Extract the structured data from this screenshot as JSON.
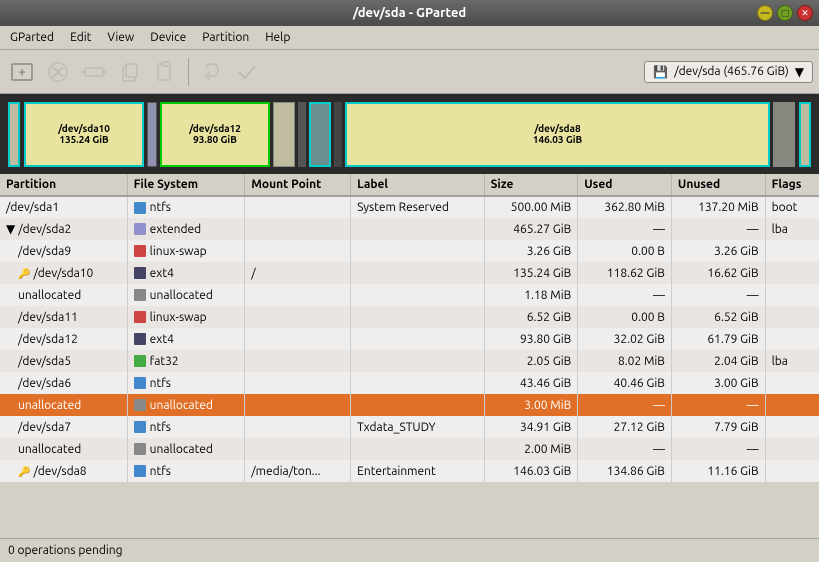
{
  "titlebar": {
    "title": "/dev/sda - GParted"
  },
  "menubar": {
    "items": [
      "GParted",
      "Edit",
      "View",
      "Device",
      "Partition",
      "Help"
    ]
  },
  "toolbar": {
    "icons": [
      {
        "name": "new-partition-icon",
        "symbol": "⊕",
        "disabled": false
      },
      {
        "name": "delete-icon",
        "symbol": "⊘",
        "disabled": false
      },
      {
        "name": "resize-icon",
        "symbol": "⇔",
        "disabled": false
      },
      {
        "name": "copy-icon",
        "symbol": "⎘",
        "disabled": false
      },
      {
        "name": "paste-icon",
        "symbol": "📋",
        "disabled": false
      },
      {
        "name": "undo-icon",
        "symbol": "↩",
        "disabled": false
      },
      {
        "name": "apply-icon",
        "symbol": "✓",
        "disabled": false
      }
    ],
    "device_label": "/dev/sda  (465.76 GiB)",
    "device_icon": "💾"
  },
  "disk_visual": {
    "parts": [
      {
        "id": "sda1",
        "label": "",
        "size": "",
        "style": "sda1"
      },
      {
        "id": "sda10",
        "label": "/dev/sda10",
        "size": "135.24 GiB",
        "style": "sda10"
      },
      {
        "id": "sda12",
        "label": "/dev/sda12",
        "size": "93.80 GiB",
        "style": "sda12"
      },
      {
        "id": "sda8",
        "label": "/dev/sda8",
        "size": "146.03 GiB",
        "style": "sda8"
      }
    ]
  },
  "table": {
    "headers": [
      "Partition",
      "File System",
      "Mount Point",
      "Label",
      "Size",
      "Used",
      "Unused",
      "Flags"
    ],
    "rows": [
      {
        "partition": "/dev/sda1",
        "indent": 0,
        "fs": "ntfs",
        "fs_color": "#4488cc",
        "mount": "",
        "label": "System Reserved",
        "size": "500.00 MiB",
        "used": "362.80 MiB",
        "unused": "137.20 MiB",
        "flags": "boot",
        "selected": false
      },
      {
        "partition": "/dev/sda2",
        "indent": 0,
        "fs": "extended",
        "fs_color": "#8888cc",
        "mount": "",
        "label": "",
        "size": "465.27 GiB",
        "used": "—",
        "unused": "—",
        "flags": "lba",
        "selected": false,
        "expand": true
      },
      {
        "partition": "/dev/sda9",
        "indent": 1,
        "fs": "linux-swap",
        "fs_color": "#cc4444",
        "mount": "",
        "label": "",
        "size": "3.26 GiB",
        "used": "0.00 B",
        "unused": "3.26 GiB",
        "flags": "",
        "selected": false
      },
      {
        "partition": "/dev/sda10",
        "indent": 1,
        "fs": "ext4",
        "fs_color": "#444466",
        "mount": "/",
        "label": "",
        "size": "135.24 GiB",
        "used": "118.62 GiB",
        "unused": "16.62 GiB",
        "flags": "",
        "selected": false,
        "key": true
      },
      {
        "partition": "unallocated",
        "indent": 1,
        "fs": "unallocated",
        "fs_color": "#888888",
        "mount": "",
        "label": "",
        "size": "1.18 MiB",
        "used": "—",
        "unused": "—",
        "flags": "",
        "selected": false
      },
      {
        "partition": "/dev/sda11",
        "indent": 1,
        "fs": "linux-swap",
        "fs_color": "#cc4444",
        "mount": "",
        "label": "",
        "size": "6.52 GiB",
        "used": "0.00 B",
        "unused": "6.52 GiB",
        "flags": "",
        "selected": false
      },
      {
        "partition": "/dev/sda12",
        "indent": 1,
        "fs": "ext4",
        "fs_color": "#444466",
        "mount": "",
        "label": "",
        "size": "93.80 GiB",
        "used": "32.02 GiB",
        "unused": "61.79 GiB",
        "flags": "",
        "selected": false
      },
      {
        "partition": "/dev/sda5",
        "indent": 1,
        "fs": "fat32",
        "fs_color": "#44aa44",
        "mount": "",
        "label": "",
        "size": "2.05 GiB",
        "used": "8.02 MiB",
        "unused": "2.04 GiB",
        "flags": "lba",
        "selected": false
      },
      {
        "partition": "/dev/sda6",
        "indent": 1,
        "fs": "ntfs",
        "fs_color": "#4488cc",
        "mount": "",
        "label": "",
        "size": "43.46 GiB",
        "used": "40.46 GiB",
        "unused": "3.00 GiB",
        "flags": "",
        "selected": false
      },
      {
        "partition": "unallocated",
        "indent": 1,
        "fs": "unallocated",
        "fs_color": "#888888",
        "mount": "",
        "label": "",
        "size": "3.00 MiB",
        "used": "—",
        "unused": "—",
        "flags": "",
        "selected": true
      },
      {
        "partition": "/dev/sda7",
        "indent": 1,
        "fs": "ntfs",
        "fs_color": "#4488cc",
        "mount": "",
        "label": "Txdata_STUDY",
        "size": "34.91 GiB",
        "used": "27.12 GiB",
        "unused": "7.79 GiB",
        "flags": "",
        "selected": false
      },
      {
        "partition": "unallocated",
        "indent": 1,
        "fs": "unallocated",
        "fs_color": "#888888",
        "mount": "",
        "label": "",
        "size": "2.00 MiB",
        "used": "—",
        "unused": "—",
        "flags": "",
        "selected": false
      },
      {
        "partition": "/dev/sda8",
        "indent": 1,
        "fs": "ntfs",
        "fs_color": "#4488cc",
        "mount": "/media/ton...",
        "label": "Entertainment",
        "size": "146.03 GiB",
        "used": "134.86 GiB",
        "unused": "11.16 GiB",
        "flags": "",
        "selected": false,
        "key": true
      }
    ]
  },
  "statusbar": {
    "text": "0 operations pending"
  }
}
